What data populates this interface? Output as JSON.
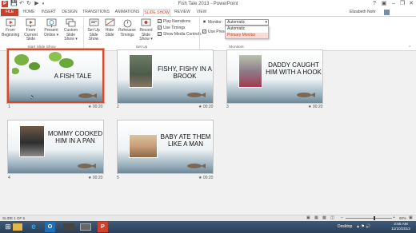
{
  "window": {
    "title": "Fish Tale 2013 - PowerPoint",
    "user": "Elizabeth Nohr"
  },
  "tabs": [
    "FILE",
    "HOME",
    "INSERT",
    "DESIGN",
    "TRANSITIONS",
    "ANIMATIONS",
    "SLIDE SHOW",
    "REVIEW",
    "VIEW"
  ],
  "active_tab": "SLIDE SHOW",
  "ribbon": {
    "start_group": {
      "label": "Start Slide Show",
      "from_beginning": [
        "From",
        "Beginning"
      ],
      "from_current": [
        "From",
        "Current Slide"
      ],
      "present_online": [
        "Present",
        "Online ▾"
      ],
      "custom_show": [
        "Custom Slide",
        "Show ▾"
      ]
    },
    "setup_group": {
      "label": "Set Up",
      "setup_show": [
        "Set Up",
        "Slide Show"
      ],
      "hide_slide": [
        "Hide",
        "Slide"
      ],
      "rehearse": [
        "Rehearse",
        "Timings"
      ],
      "record": [
        "Record Slide",
        "Show ▾"
      ],
      "play_narrations": "Play Narrations",
      "use_timings": "Use Timings",
      "show_media_controls": "Show Media Controls",
      "play_narrations_checked": true,
      "use_timings_checked": true,
      "show_media_controls_checked": true
    },
    "monitors_group": {
      "label": "Monitors",
      "monitor_label": "Monitor:",
      "monitor_value": "Automatic",
      "use_presenter_label": "Use Prese",
      "dropdown_options": [
        "Automatic",
        "Primary Monitor"
      ],
      "highlighted_option": "Primary Monitor"
    }
  },
  "slides": [
    {
      "number": "1",
      "title": "A FISH TALE",
      "duration": "00:20",
      "selected": true
    },
    {
      "number": "2",
      "title": "FISHY, FISHY IN A BROOK",
      "duration": "00:20"
    },
    {
      "number": "3",
      "title": "DADDY CAUGHT HIM WITH A HOOK",
      "duration": "00:20"
    },
    {
      "number": "4",
      "title": "MOMMY COOKED HIM IN A PAN",
      "duration": "00:20"
    },
    {
      "number": "5",
      "title": "BABY ATE THEM LIKE A MAN",
      "duration": "00:20"
    }
  ],
  "status": {
    "slide_indicator": "SLIDE 1 OF 5",
    "zoom": "90%"
  },
  "taskbar": {
    "desktop_label": "Desktop",
    "time": "2:55 AM",
    "date": "11/10/2013"
  },
  "colors": {
    "accent": "#c8422d",
    "ribbon_bg": "#ffffff",
    "canvas_bg": "#f1f1f1",
    "taskbar": "#2f4560"
  }
}
